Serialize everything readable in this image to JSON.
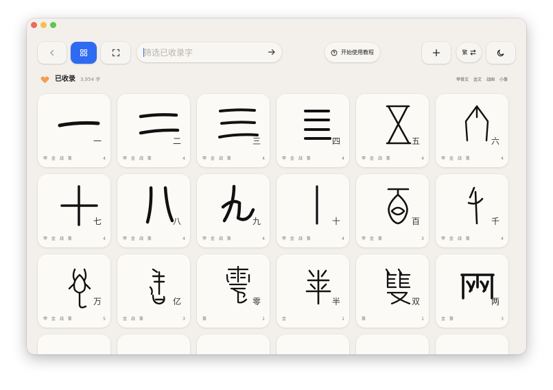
{
  "toolbar": {
    "back_icon": "chevron-left-icon",
    "grid_icon": "grid-icon",
    "fullscreen_icon": "expand-icon",
    "search_placeholder": "筛选已收录字",
    "search_value": "",
    "tutorial_label": "开始使用教程",
    "convert_label": "繁",
    "add_icon": "plus-icon",
    "theme_icon": "moon-icon"
  },
  "collection": {
    "label": "已收录",
    "count": "3,954 字",
    "scripts": [
      "甲骨文",
      "金文",
      "战国",
      "小篆"
    ]
  },
  "colors": {
    "accent": "#2f6bf2",
    "background": "#f3f0eb",
    "card": "#fbfaf7",
    "heart": "#f0a050"
  },
  "cards": [
    {
      "char": "一",
      "forms": "甲 金 战 篆",
      "count": "4"
    },
    {
      "char": "二",
      "forms": "甲 金 战 篆",
      "count": "4"
    },
    {
      "char": "三",
      "forms": "甲 金 战 篆",
      "count": "4"
    },
    {
      "char": "四",
      "forms": "甲 金 战 篆",
      "count": "4"
    },
    {
      "char": "五",
      "forms": "甲 金 战 篆",
      "count": "4"
    },
    {
      "char": "六",
      "forms": "甲 金 战 篆",
      "count": "4"
    },
    {
      "char": "七",
      "forms": "甲 金 战 篆",
      "count": "4"
    },
    {
      "char": "八",
      "forms": "甲 金 战 篆",
      "count": "4"
    },
    {
      "char": "九",
      "forms": "甲 金 战 篆",
      "count": "4"
    },
    {
      "char": "十",
      "forms": "甲 金 战 篆",
      "count": "4"
    },
    {
      "char": "百",
      "forms": "甲 金 篆",
      "count": "3"
    },
    {
      "char": "千",
      "forms": "甲 金 战 篆",
      "count": "4"
    },
    {
      "char": "万",
      "forms": "甲 金 战 篆",
      "count": "5"
    },
    {
      "char": "亿",
      "forms": "金 战 篆",
      "count": "3"
    },
    {
      "char": "零",
      "forms": "篆",
      "count": "1"
    },
    {
      "char": "半",
      "forms": "金",
      "count": "1"
    },
    {
      "char": "双",
      "forms": "篆",
      "count": "1"
    },
    {
      "char": "两",
      "forms": "金 篆",
      "count": "3"
    }
  ]
}
